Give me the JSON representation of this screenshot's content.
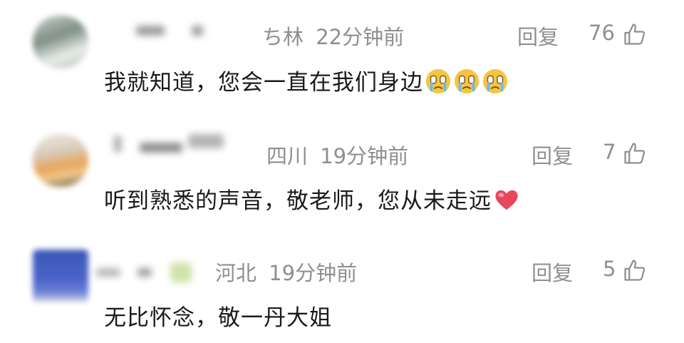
{
  "comments": [
    {
      "location": "ち林",
      "time": "22分钟前",
      "reply_label": "回复",
      "likes": "76",
      "text": "我就知道，您会一直在我们身边",
      "emojis": [
        "crying-face-emoji",
        "crying-face-emoji",
        "crying-face-emoji"
      ]
    },
    {
      "location": "四川",
      "time": "19分钟前",
      "reply_label": "回复",
      "likes": "7",
      "text": "听到熟悉的声音，敬老师，您从未走远",
      "emojis": [
        "heart-emoji"
      ]
    },
    {
      "location": "河北",
      "time": "19分钟前",
      "reply_label": "回复",
      "likes": "5",
      "text": "无比怀念，敬一丹大姐",
      "emojis": []
    }
  ],
  "icons": {
    "like": "thumbs-up-icon"
  },
  "colors": {
    "meta": "#8f8f8f",
    "text": "#1a1a1a",
    "heart": "#e8465a",
    "emoji": "#f5c542"
  }
}
